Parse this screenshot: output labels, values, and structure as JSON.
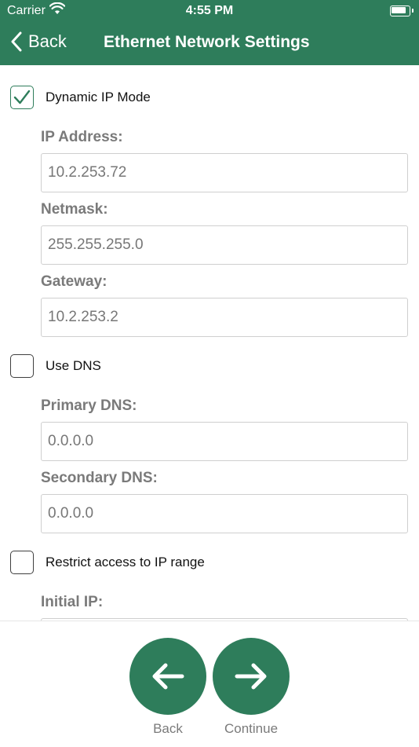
{
  "status_bar": {
    "carrier": "Carrier",
    "time": "4:55 PM"
  },
  "nav": {
    "back_label": "Back",
    "title": "Ethernet Network Settings"
  },
  "dynamic_ip": {
    "label": "Dynamic IP Mode",
    "checked": true
  },
  "ip_address": {
    "label": "IP Address:",
    "value": "10.2.253.72"
  },
  "netmask": {
    "label": "Netmask:",
    "value": "255.255.255.0"
  },
  "gateway": {
    "label": "Gateway:",
    "value": "10.2.253.2"
  },
  "use_dns": {
    "label": "Use DNS",
    "checked": false
  },
  "primary_dns": {
    "label": "Primary DNS:",
    "value": "0.0.0.0"
  },
  "secondary_dns": {
    "label": "Secondary DNS:",
    "value": "0.0.0.0"
  },
  "restrict_ip": {
    "label": "Restrict access to IP range",
    "checked": false
  },
  "initial_ip": {
    "label": "Initial IP:",
    "value": ""
  },
  "footer": {
    "back_label": "Back",
    "continue_label": "Continue"
  },
  "colors": {
    "accent": "#2e7d5b"
  }
}
